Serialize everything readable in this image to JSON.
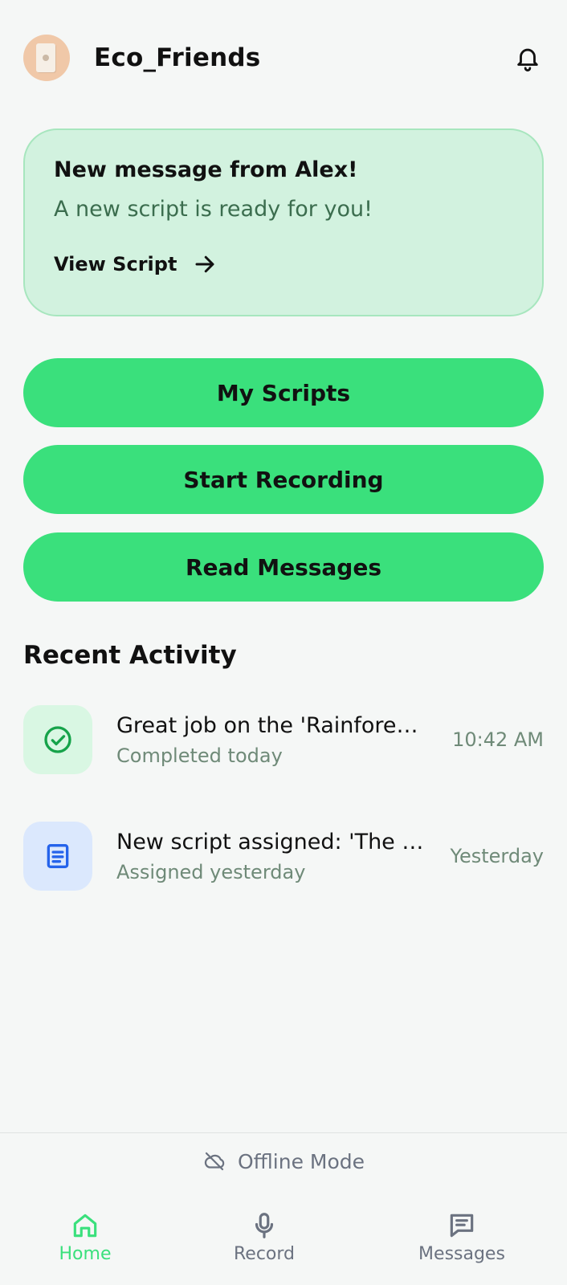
{
  "header": {
    "title": "Eco_Friends",
    "avatar_icon": "avatar-image",
    "bell_icon": "bell-icon"
  },
  "notice": {
    "title": "New message from Alex!",
    "subtitle": "A new script is ready for you!",
    "link_label": "View Script",
    "link_icon": "arrow-right-icon"
  },
  "actions": {
    "my_scripts": "My Scripts",
    "start_recording": "Start Recording",
    "read_messages": "Read Messages"
  },
  "recent": {
    "title": "Recent Activity",
    "items": [
      {
        "title": "Great job on the 'Rainforest' script!",
        "subtitle": "Completed today",
        "time": "10:42 AM",
        "icon": "check-circle-icon"
      },
      {
        "title": "New script assigned: 'The Ocean'",
        "subtitle": "Assigned yesterday",
        "time": "Yesterday",
        "icon": "document-icon"
      }
    ]
  },
  "status": {
    "offline_label": "Offline Mode",
    "offline_icon": "cloud-off-icon"
  },
  "nav": {
    "home": "Home",
    "record": "Record",
    "messages": "Messages",
    "active": "Home"
  },
  "colors": {
    "accent": "#3ae07c",
    "notice_bg": "#d2f2df",
    "muted_green": "#6f8a78",
    "doc_blue": "#2563eb"
  }
}
